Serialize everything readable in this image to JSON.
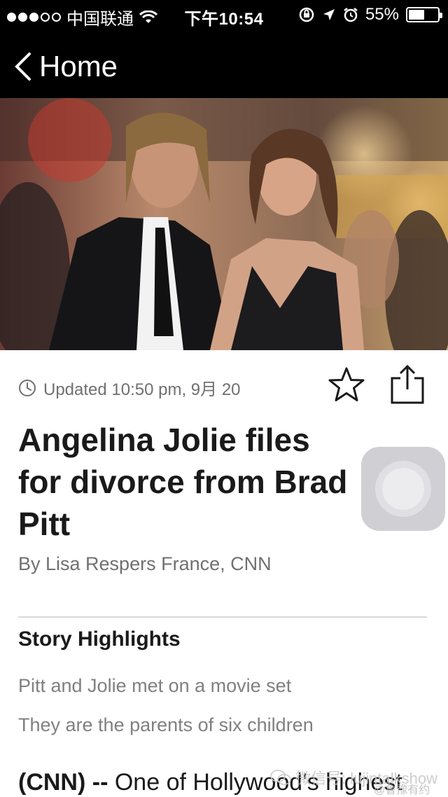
{
  "status_bar": {
    "carrier": "中国联通",
    "time": "下午10:54",
    "battery_percent": "55%",
    "battery_level": 0.55
  },
  "nav": {
    "back_label": "Home"
  },
  "article": {
    "updated": "Updated 10:50 pm, 9月 20",
    "headline": "Angelina Jolie files for divorce from Brad Pitt",
    "byline": "By Lisa Respers France, CNN",
    "highlights_title": "Story Highlights",
    "highlights": [
      "Pitt and Jolie met on a movie set",
      "They are the parents of six children"
    ],
    "lead_source": "(CNN) --",
    "lead_text": " One of Hollywood's highest"
  },
  "watermark": {
    "text": "微信号: lujintalkshow",
    "sub": "@鲁豫有约"
  },
  "icons": {
    "back": "chevron-left-icon",
    "clock": "clock-icon",
    "star": "star-icon",
    "share": "share-icon",
    "wifi": "wifi-icon"
  },
  "colors": {
    "bars": "#000000",
    "meta_text": "#707070",
    "headline": "#1a1a1a"
  }
}
